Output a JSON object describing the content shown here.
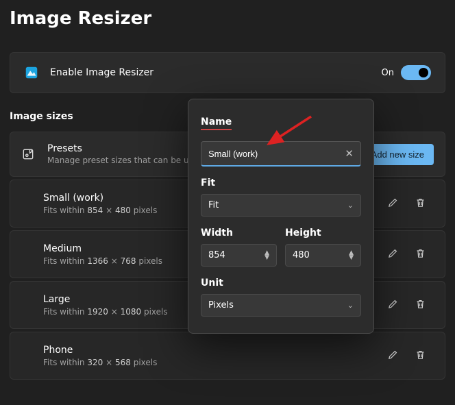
{
  "title": "Image Resizer",
  "enable": {
    "label": "Enable Image Resizer",
    "state": "On"
  },
  "section_label": "Image sizes",
  "presets": {
    "title": "Presets",
    "subtitle": "Manage preset sizes that can be used i",
    "add_label": "Add new size"
  },
  "sizes": [
    {
      "name": "Small (work)",
      "prefix": "Fits within",
      "w": "854",
      "h": "480",
      "unit": "pixels"
    },
    {
      "name": "Medium",
      "prefix": "Fits within",
      "w": "1366",
      "h": "768",
      "unit": "pixels"
    },
    {
      "name": "Large",
      "prefix": "Fits within",
      "w": "1920",
      "h": "1080",
      "unit": "pixels"
    },
    {
      "name": "Phone",
      "prefix": "Fits within",
      "w": "320",
      "h": "568",
      "unit": "pixels"
    }
  ],
  "popup": {
    "name_label": "Name",
    "name_value": "Small (work)",
    "fit_label": "Fit",
    "fit_value": "Fit",
    "width_label": "Width",
    "width_value": "854",
    "height_label": "Height",
    "height_value": "480",
    "unit_label": "Unit",
    "unit_value": "Pixels"
  }
}
